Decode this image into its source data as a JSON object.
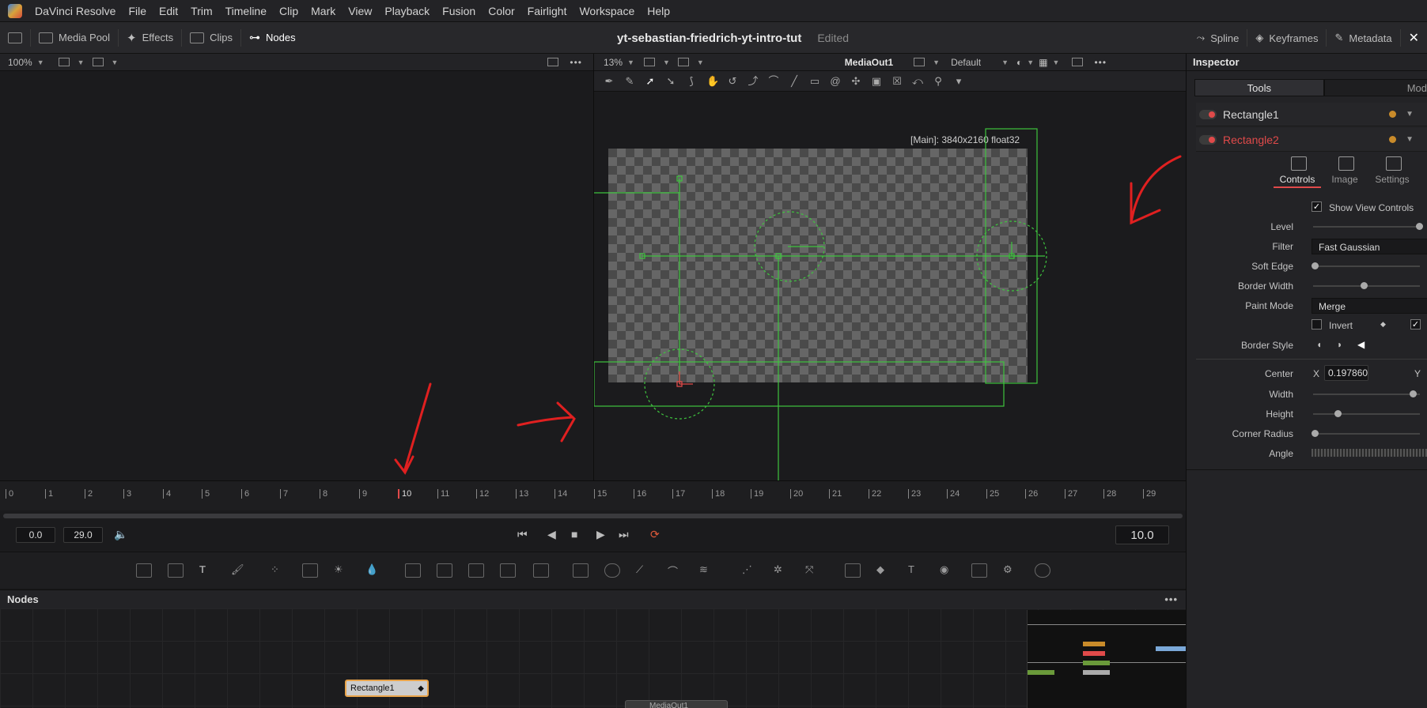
{
  "menubar": {
    "app_name": "DaVinci Resolve",
    "items": [
      "File",
      "Edit",
      "Trim",
      "Timeline",
      "Clip",
      "Mark",
      "View",
      "Playback",
      "Fusion",
      "Color",
      "Fairlight",
      "Workspace",
      "Help"
    ]
  },
  "toolbar": {
    "media_pool": "Media Pool",
    "effects": "Effects",
    "clips": "Clips",
    "nodes": "Nodes",
    "project_title": "yt-sebastian-friedrich-yt-intro-tut",
    "project_status": "Edited",
    "spline": "Spline",
    "keyframes": "Keyframes",
    "metadata": "Metadata"
  },
  "left_viewer": {
    "zoom": "100%"
  },
  "right_viewer": {
    "zoom": "13%",
    "node_name": "MediaOut1",
    "lut": "Default",
    "resolution_label": "[Main]: 3840x2160 float32"
  },
  "timeline": {
    "ticks": [
      "0",
      "1",
      "2",
      "3",
      "4",
      "5",
      "6",
      "7",
      "8",
      "9",
      "10",
      "11",
      "12",
      "13",
      "14",
      "15",
      "16",
      "17",
      "18",
      "19",
      "20",
      "21",
      "22",
      "23",
      "24",
      "25",
      "26",
      "27",
      "28",
      "29"
    ],
    "start": "0.0",
    "end": "29.0",
    "current_time": "10.0"
  },
  "nodes_panel": {
    "title": "Nodes",
    "node_rect1": "Rectangle1",
    "node_mediaout": "MediaOut1"
  },
  "inspector": {
    "title": "Inspector",
    "tabs": [
      "Tools",
      "Mod"
    ],
    "tools": [
      {
        "name": "Rectangle1",
        "color": "#d8d8d8"
      },
      {
        "name": "Rectangle2",
        "color": "#e04a4a"
      }
    ],
    "subtabs": [
      "Controls",
      "Image",
      "Settings"
    ],
    "show_view_controls": "Show View Controls",
    "level": "Level",
    "filter": "Filter",
    "filter_value": "Fast Gaussian",
    "soft_edge": "Soft Edge",
    "border_width": "Border Width",
    "paint_mode": "Paint Mode",
    "paint_mode_value": "Merge",
    "invert": "Invert",
    "border_style": "Border Style",
    "center": "Center",
    "center_x_label": "X",
    "center_x_value": "0.197860",
    "center_y_label": "Y",
    "width": "Width",
    "height": "Height",
    "corner_radius": "Corner Radius",
    "angle": "Angle"
  },
  "colors": {
    "accent_red": "#e04a4a",
    "overlay_green": "#3ec43e",
    "annotation_red": "#e02020"
  }
}
